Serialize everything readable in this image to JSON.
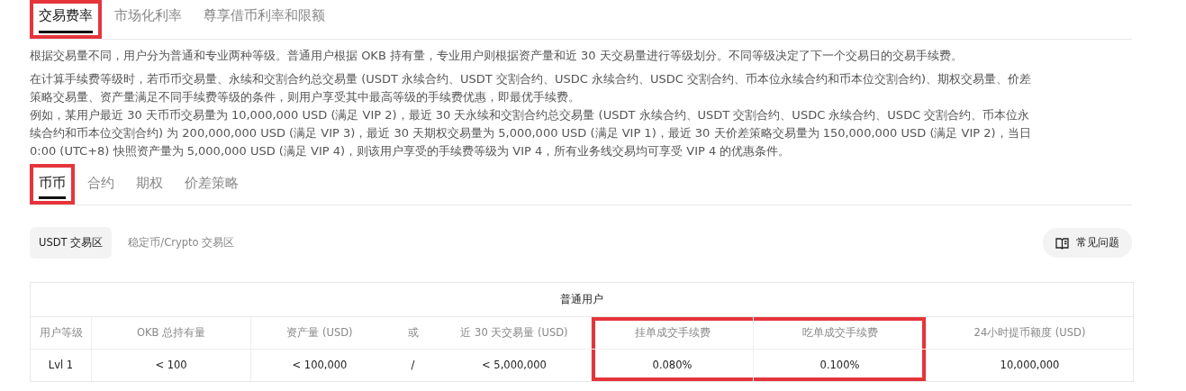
{
  "top_tabs": [
    {
      "label": "交易费率",
      "selected": true,
      "highlighted": true
    },
    {
      "label": "市场化利率",
      "selected": false,
      "highlighted": false
    },
    {
      "label": "尊享借币利率和限额",
      "selected": false,
      "highlighted": false
    }
  ],
  "paragraphs": [
    [
      "根据交易量不同，用户分为普通和专业两种等级。普通用户根据 OKB 持有量，专业用户则根据资产量和近 30 天交易量进行等级划分。不同等级决定了下一个交易日的交易手续费。"
    ],
    [
      "在计算手续费等级时，若币币交易量、永续和交割合约总交易量 (USDT 永续合约、USDT 交割合约、USDC 永续合约、USDC 交割合约、币本位永续合约和币本位交割合约)、期权交易量、价差策略交易量、资产量满足不同手续费等级的条件，则用户享受其中最高等级的手续费优惠，即最优手续费。",
      "例如，某用户最近 30 天币币交易量为 10,000,000 USD (满足 VIP 2)，最近 30 天永续和交割合约总交易量 (USDT 永续合约、USDT 交割合约、USDC 永续合约、USDC 交割合约、币本位永续合约和币本位交割合约) 为 200,000,000 USD (满足 VIP 3)，最近 30 天期权交易量为 5,000,000 USD (满足 VIP 1)，最近 30 天价差策略交易量为 150,000,000 USD (满足 VIP 2)，当日 0:00 (UTC+8) 快照资产量为 5,000,000 USD (满足 VIP 4)，则该用户享受的手续费等级为 VIP 4，所有业务线交易均可享受 VIP 4 的优惠条件。"
    ]
  ],
  "product_tabs": [
    {
      "label": "币币",
      "selected": true,
      "highlighted": true
    },
    {
      "label": "合约",
      "selected": false,
      "highlighted": false
    },
    {
      "label": "期权",
      "selected": false,
      "highlighted": false
    },
    {
      "label": "价差策略",
      "selected": false,
      "highlighted": false
    }
  ],
  "zones": [
    {
      "label": "USDT 交易区",
      "selected": true
    },
    {
      "label": "稳定币/Crypto 交易区",
      "selected": false
    }
  ],
  "faq_button": "常见问题",
  "table": {
    "group_title": "普通用户",
    "columns": [
      {
        "label": "用户等级",
        "kind": "label",
        "highlighted": false
      },
      {
        "label": "OKB 总持有量",
        "kind": "label",
        "highlighted": false
      },
      {
        "label": "资产量 (USD)",
        "kind": "label",
        "highlighted": false
      },
      {
        "label": "或",
        "kind": "connector",
        "highlighted": false
      },
      {
        "label": "近 30 天交易量 (USD)",
        "kind": "label",
        "highlighted": false
      },
      {
        "label": "挂单成交手续费",
        "kind": "label",
        "highlighted": true
      },
      {
        "label": "吃单成交手续费",
        "kind": "label",
        "highlighted": true
      },
      {
        "label": "24小时提币额度 (USD)",
        "kind": "label",
        "highlighted": false
      }
    ],
    "rows": [
      [
        "Lvl 1",
        "< 100",
        "< 100,000",
        "/",
        "< 5,000,000",
        "0.080%",
        "0.100%",
        "10,000,000"
      ]
    ]
  }
}
